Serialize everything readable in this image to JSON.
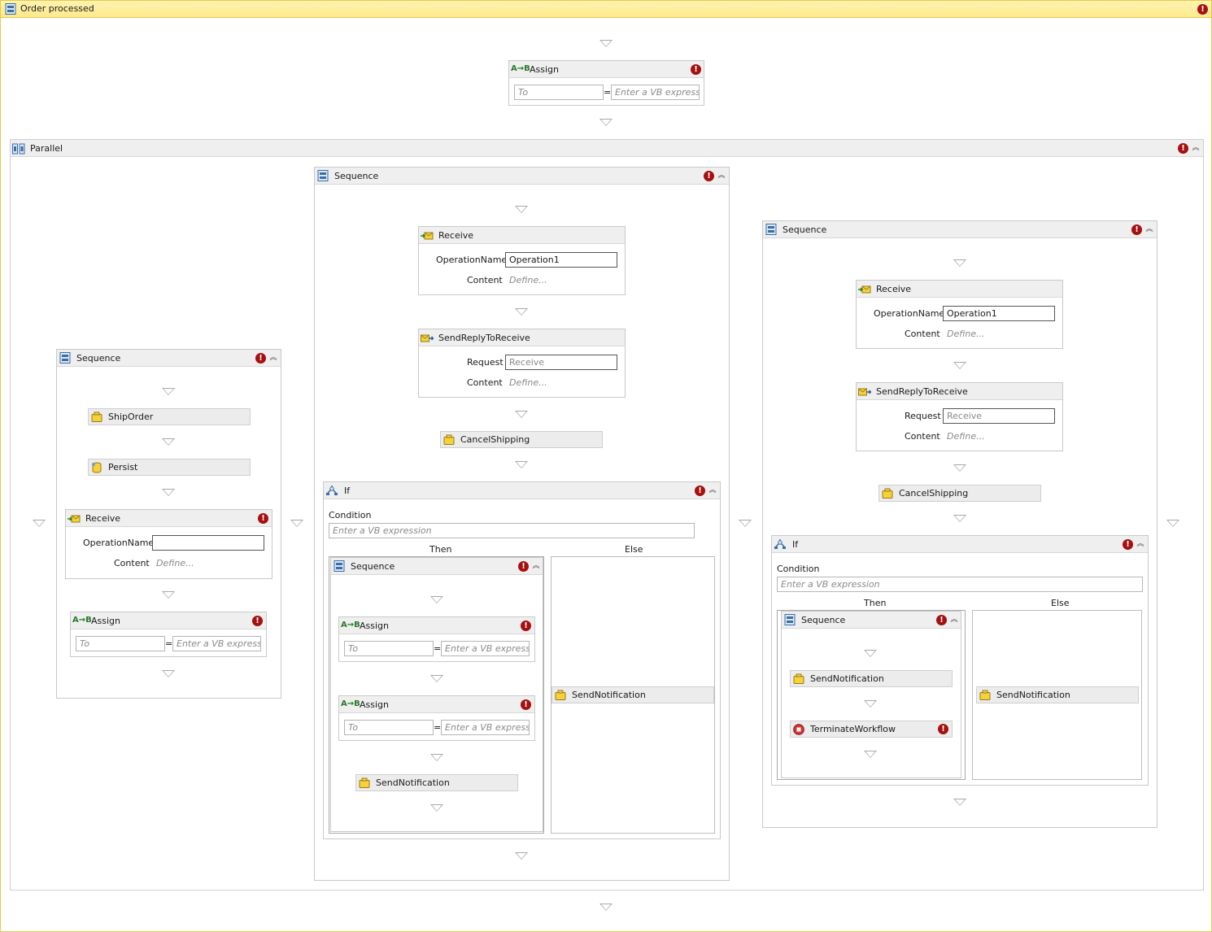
{
  "root": {
    "title": "Order processed"
  },
  "assign_top": {
    "title": "Assign",
    "to_placeholder": "To",
    "value_placeholder": "Enter a VB expressic"
  },
  "parallel": {
    "title": "Parallel"
  },
  "left_seq": {
    "title": "Sequence",
    "ship_order": "ShipOrder",
    "persist": "Persist",
    "receive": {
      "title": "Receive",
      "op_label": "OperationName",
      "op_value": "",
      "content_label": "Content",
      "content_value": "Define..."
    },
    "assign": {
      "title": "Assign",
      "to_placeholder": "To",
      "value_placeholder": "Enter a VB expressic"
    }
  },
  "mid_seq": {
    "title": "Sequence",
    "receive": {
      "title": "Receive",
      "op_label": "OperationName",
      "op_value": "Operation1",
      "content_label": "Content",
      "content_value": "Define..."
    },
    "reply": {
      "title": "SendReplyToReceive",
      "req_label": "Request",
      "req_value": "Receive",
      "content_label": "Content",
      "content_value": "Define..."
    },
    "cancel": "CancelShipping",
    "if": {
      "title": "If",
      "condition_label": "Condition",
      "condition_placeholder": "Enter a VB expression",
      "then_label": "Then",
      "else_label": "Else",
      "then_seq": {
        "title": "Sequence",
        "assign1": {
          "title": "Assign",
          "to_placeholder": "To",
          "value_placeholder": "Enter a VB expressic"
        },
        "assign2": {
          "title": "Assign",
          "to_placeholder": "To",
          "value_placeholder": "Enter a VB expressic"
        },
        "notify": "SendNotification"
      },
      "else_notify": "SendNotification"
    }
  },
  "right_seq": {
    "title": "Sequence",
    "receive": {
      "title": "Receive",
      "op_label": "OperationName",
      "op_value": "Operation1",
      "content_label": "Content",
      "content_value": "Define..."
    },
    "reply": {
      "title": "SendReplyToReceive",
      "req_label": "Request",
      "req_value": "Receive",
      "content_label": "Content",
      "content_value": "Define..."
    },
    "cancel": "CancelShipping",
    "if": {
      "title": "If",
      "condition_label": "Condition",
      "condition_placeholder": "Enter a VB expression",
      "then_label": "Then",
      "else_label": "Else",
      "then_seq": {
        "title": "Sequence",
        "notify": "SendNotification",
        "terminate": "TerminateWorkflow"
      },
      "else_notify": "SendNotification"
    }
  },
  "icons": {
    "sequence": "sequence-icon",
    "assign": "assign-icon",
    "parallel": "parallel-icon",
    "receive": "receive-icon",
    "send_reply": "send-reply-icon",
    "activity": "activity-icon",
    "persist": "persist-icon",
    "if": "if-icon",
    "terminate": "terminate-icon",
    "error": "error-icon",
    "collapse": "collapse-icon",
    "drop": "drop-target-icon"
  },
  "colors": {
    "root_header": "#fde98d",
    "root_border": "#e7c94a",
    "error": "#a51010",
    "header": "#efefef"
  }
}
